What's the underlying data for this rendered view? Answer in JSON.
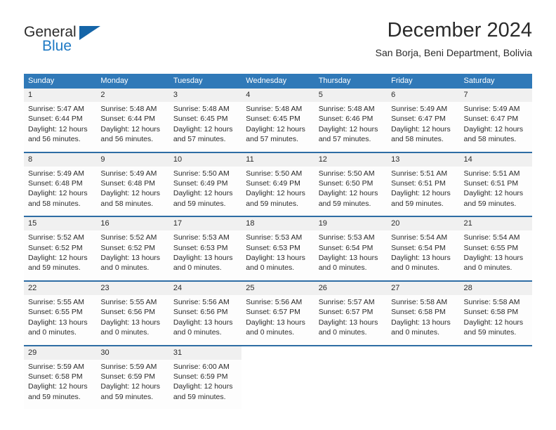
{
  "brand": {
    "word_one": "General",
    "word_two": "Blue",
    "flag_icon": "triangle-flag-icon",
    "accent_color": "#1f7ac4"
  },
  "header": {
    "title": "December 2024",
    "subtitle": "San Borja, Beni Department, Bolivia"
  },
  "colors": {
    "header_row": "#3079b8",
    "daynum_band": "#f0f0f0",
    "daynum_border": "#2e6da4",
    "text": "#2b2b2b"
  },
  "weekdays": [
    "Sunday",
    "Monday",
    "Tuesday",
    "Wednesday",
    "Thursday",
    "Friday",
    "Saturday"
  ],
  "weeks": [
    [
      {
        "day": "1",
        "sunrise": "Sunrise: 5:47 AM",
        "sunset": "Sunset: 6:44 PM",
        "daylight1": "Daylight: 12 hours",
        "daylight2": "and 56 minutes."
      },
      {
        "day": "2",
        "sunrise": "Sunrise: 5:48 AM",
        "sunset": "Sunset: 6:44 PM",
        "daylight1": "Daylight: 12 hours",
        "daylight2": "and 56 minutes."
      },
      {
        "day": "3",
        "sunrise": "Sunrise: 5:48 AM",
        "sunset": "Sunset: 6:45 PM",
        "daylight1": "Daylight: 12 hours",
        "daylight2": "and 57 minutes."
      },
      {
        "day": "4",
        "sunrise": "Sunrise: 5:48 AM",
        "sunset": "Sunset: 6:45 PM",
        "daylight1": "Daylight: 12 hours",
        "daylight2": "and 57 minutes."
      },
      {
        "day": "5",
        "sunrise": "Sunrise: 5:48 AM",
        "sunset": "Sunset: 6:46 PM",
        "daylight1": "Daylight: 12 hours",
        "daylight2": "and 57 minutes."
      },
      {
        "day": "6",
        "sunrise": "Sunrise: 5:49 AM",
        "sunset": "Sunset: 6:47 PM",
        "daylight1": "Daylight: 12 hours",
        "daylight2": "and 58 minutes."
      },
      {
        "day": "7",
        "sunrise": "Sunrise: 5:49 AM",
        "sunset": "Sunset: 6:47 PM",
        "daylight1": "Daylight: 12 hours",
        "daylight2": "and 58 minutes."
      }
    ],
    [
      {
        "day": "8",
        "sunrise": "Sunrise: 5:49 AM",
        "sunset": "Sunset: 6:48 PM",
        "daylight1": "Daylight: 12 hours",
        "daylight2": "and 58 minutes."
      },
      {
        "day": "9",
        "sunrise": "Sunrise: 5:49 AM",
        "sunset": "Sunset: 6:48 PM",
        "daylight1": "Daylight: 12 hours",
        "daylight2": "and 58 minutes."
      },
      {
        "day": "10",
        "sunrise": "Sunrise: 5:50 AM",
        "sunset": "Sunset: 6:49 PM",
        "daylight1": "Daylight: 12 hours",
        "daylight2": "and 59 minutes."
      },
      {
        "day": "11",
        "sunrise": "Sunrise: 5:50 AM",
        "sunset": "Sunset: 6:49 PM",
        "daylight1": "Daylight: 12 hours",
        "daylight2": "and 59 minutes."
      },
      {
        "day": "12",
        "sunrise": "Sunrise: 5:50 AM",
        "sunset": "Sunset: 6:50 PM",
        "daylight1": "Daylight: 12 hours",
        "daylight2": "and 59 minutes."
      },
      {
        "day": "13",
        "sunrise": "Sunrise: 5:51 AM",
        "sunset": "Sunset: 6:51 PM",
        "daylight1": "Daylight: 12 hours",
        "daylight2": "and 59 minutes."
      },
      {
        "day": "14",
        "sunrise": "Sunrise: 5:51 AM",
        "sunset": "Sunset: 6:51 PM",
        "daylight1": "Daylight: 12 hours",
        "daylight2": "and 59 minutes."
      }
    ],
    [
      {
        "day": "15",
        "sunrise": "Sunrise: 5:52 AM",
        "sunset": "Sunset: 6:52 PM",
        "daylight1": "Daylight: 12 hours",
        "daylight2": "and 59 minutes."
      },
      {
        "day": "16",
        "sunrise": "Sunrise: 5:52 AM",
        "sunset": "Sunset: 6:52 PM",
        "daylight1": "Daylight: 13 hours",
        "daylight2": "and 0 minutes."
      },
      {
        "day": "17",
        "sunrise": "Sunrise: 5:53 AM",
        "sunset": "Sunset: 6:53 PM",
        "daylight1": "Daylight: 13 hours",
        "daylight2": "and 0 minutes."
      },
      {
        "day": "18",
        "sunrise": "Sunrise: 5:53 AM",
        "sunset": "Sunset: 6:53 PM",
        "daylight1": "Daylight: 13 hours",
        "daylight2": "and 0 minutes."
      },
      {
        "day": "19",
        "sunrise": "Sunrise: 5:53 AM",
        "sunset": "Sunset: 6:54 PM",
        "daylight1": "Daylight: 13 hours",
        "daylight2": "and 0 minutes."
      },
      {
        "day": "20",
        "sunrise": "Sunrise: 5:54 AM",
        "sunset": "Sunset: 6:54 PM",
        "daylight1": "Daylight: 13 hours",
        "daylight2": "and 0 minutes."
      },
      {
        "day": "21",
        "sunrise": "Sunrise: 5:54 AM",
        "sunset": "Sunset: 6:55 PM",
        "daylight1": "Daylight: 13 hours",
        "daylight2": "and 0 minutes."
      }
    ],
    [
      {
        "day": "22",
        "sunrise": "Sunrise: 5:55 AM",
        "sunset": "Sunset: 6:55 PM",
        "daylight1": "Daylight: 13 hours",
        "daylight2": "and 0 minutes."
      },
      {
        "day": "23",
        "sunrise": "Sunrise: 5:55 AM",
        "sunset": "Sunset: 6:56 PM",
        "daylight1": "Daylight: 13 hours",
        "daylight2": "and 0 minutes."
      },
      {
        "day": "24",
        "sunrise": "Sunrise: 5:56 AM",
        "sunset": "Sunset: 6:56 PM",
        "daylight1": "Daylight: 13 hours",
        "daylight2": "and 0 minutes."
      },
      {
        "day": "25",
        "sunrise": "Sunrise: 5:56 AM",
        "sunset": "Sunset: 6:57 PM",
        "daylight1": "Daylight: 13 hours",
        "daylight2": "and 0 minutes."
      },
      {
        "day": "26",
        "sunrise": "Sunrise: 5:57 AM",
        "sunset": "Sunset: 6:57 PM",
        "daylight1": "Daylight: 13 hours",
        "daylight2": "and 0 minutes."
      },
      {
        "day": "27",
        "sunrise": "Sunrise: 5:58 AM",
        "sunset": "Sunset: 6:58 PM",
        "daylight1": "Daylight: 13 hours",
        "daylight2": "and 0 minutes."
      },
      {
        "day": "28",
        "sunrise": "Sunrise: 5:58 AM",
        "sunset": "Sunset: 6:58 PM",
        "daylight1": "Daylight: 12 hours",
        "daylight2": "and 59 minutes."
      }
    ],
    [
      {
        "day": "29",
        "sunrise": "Sunrise: 5:59 AM",
        "sunset": "Sunset: 6:58 PM",
        "daylight1": "Daylight: 12 hours",
        "daylight2": "and 59 minutes."
      },
      {
        "day": "30",
        "sunrise": "Sunrise: 5:59 AM",
        "sunset": "Sunset: 6:59 PM",
        "daylight1": "Daylight: 12 hours",
        "daylight2": "and 59 minutes."
      },
      {
        "day": "31",
        "sunrise": "Sunrise: 6:00 AM",
        "sunset": "Sunset: 6:59 PM",
        "daylight1": "Daylight: 12 hours",
        "daylight2": "and 59 minutes."
      },
      {
        "day": "",
        "sunrise": "",
        "sunset": "",
        "daylight1": "",
        "daylight2": ""
      },
      {
        "day": "",
        "sunrise": "",
        "sunset": "",
        "daylight1": "",
        "daylight2": ""
      },
      {
        "day": "",
        "sunrise": "",
        "sunset": "",
        "daylight1": "",
        "daylight2": ""
      },
      {
        "day": "",
        "sunrise": "",
        "sunset": "",
        "daylight1": "",
        "daylight2": ""
      }
    ]
  ]
}
